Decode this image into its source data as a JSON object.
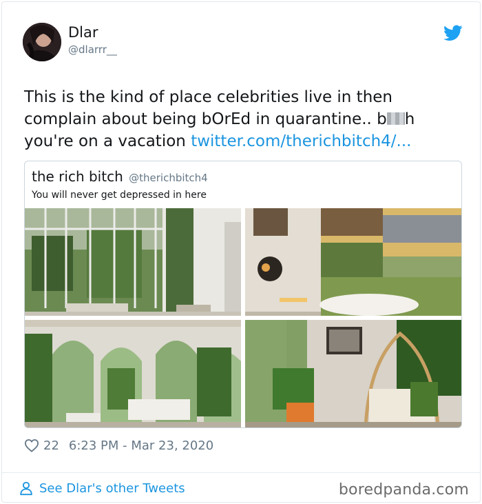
{
  "tweet": {
    "author": {
      "display_name": "Dlar",
      "handle": "@dlarrr__"
    },
    "text_before": "This is the kind of place celebrities live in then complain about being bOrEd in quarantine.. b",
    "text_after": "h you're on a vacation ",
    "link": "twitter.com/therichbitch4/...",
    "likes": "22",
    "timestamp": "6:23 PM - Mar 23, 2020",
    "footer_link": "See Dlar's other Tweets"
  },
  "quote": {
    "display_name": "the rich bitch",
    "handle": "@therichbitch4",
    "text": "You will never get depressed in here"
  },
  "icons": {
    "platform": "twitter-bird-icon",
    "like": "heart-icon",
    "profile": "person-icon"
  },
  "watermark": "boredpanda.com",
  "colors": {
    "link": "#1b95e0",
    "twitter_blue": "#1da1f2",
    "muted": "#657786"
  }
}
